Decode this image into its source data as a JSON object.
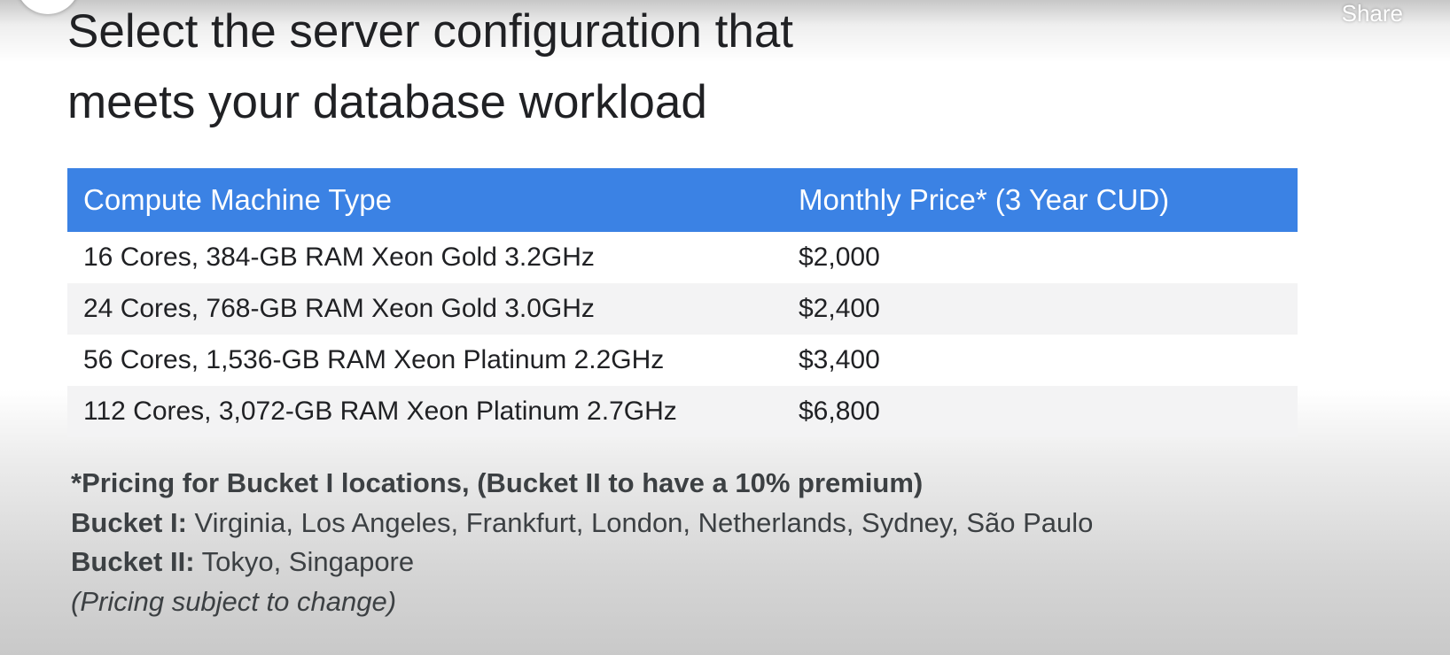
{
  "header": {
    "share_label": "Share"
  },
  "slide": {
    "title_line1": "Select the server configuration that",
    "title_line2": "meets your database workload"
  },
  "table": {
    "headers": {
      "machine_type": "Compute Machine Type",
      "monthly_price": "Monthly Price* (3 Year CUD)"
    },
    "rows": [
      {
        "machine_type": "16 Cores, 384-GB RAM Xeon Gold 3.2GHz",
        "price": "$2,000"
      },
      {
        "machine_type": "24 Cores, 768-GB RAM Xeon Gold 3.0GHz",
        "price": "$2,400"
      },
      {
        "machine_type": "56 Cores, 1,536-GB RAM Xeon Platinum 2.2GHz",
        "price": "$3,400"
      },
      {
        "machine_type": "112 Cores, 3,072-GB RAM Xeon Platinum 2.7GHz",
        "price": "$6,800"
      }
    ]
  },
  "notes": {
    "pricing_note": "*Pricing for Bucket I locations, (Bucket II to have a 10% premium)",
    "bucket1_label": "Bucket I:",
    "bucket1_locations": " Virginia, Los Angeles, Frankfurt, London, Netherlands, Sydney, São Paulo",
    "bucket2_label": "Bucket II:",
    "bucket2_locations": " Tokyo, Singapore",
    "disclaimer": "(Pricing subject to change)"
  },
  "colors": {
    "header_blue": "#3b82e4",
    "row_alt": "#f3f3f4",
    "text_dark": "#202124"
  }
}
